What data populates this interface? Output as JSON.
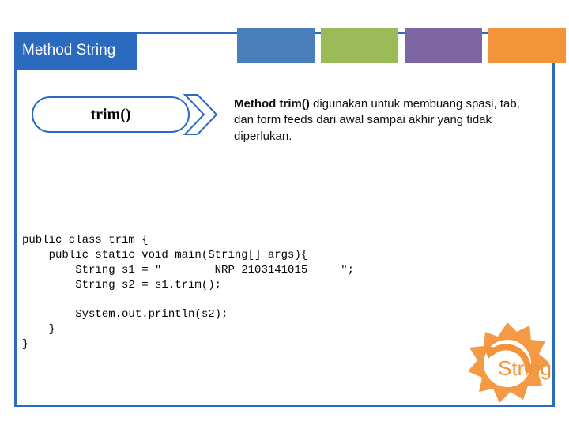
{
  "header": {
    "title": "Method String"
  },
  "tabs": {
    "colors": [
      "#4a7dbb",
      "#9bbb59",
      "#7d64a2",
      "#f3933a"
    ]
  },
  "method": {
    "name": "trim()"
  },
  "description": {
    "bold": "Method trim()",
    "text": " digunakan untuk membuang spasi, tab, dan form feeds dari awal sampai akhir yang tidak diperlukan."
  },
  "code": {
    "lines": [
      "public class trim {",
      "    public static void main(String[] args){",
      "        String s1 = \"        NRP 2103141015     \";",
      "        String s2 = s1.trim();",
      "",
      "        System.out.println(s2);",
      "    }",
      "}"
    ]
  },
  "footer": {
    "gear_label": "String"
  },
  "colors": {
    "primary": "#2a6abf",
    "accent": "#f3933a"
  }
}
